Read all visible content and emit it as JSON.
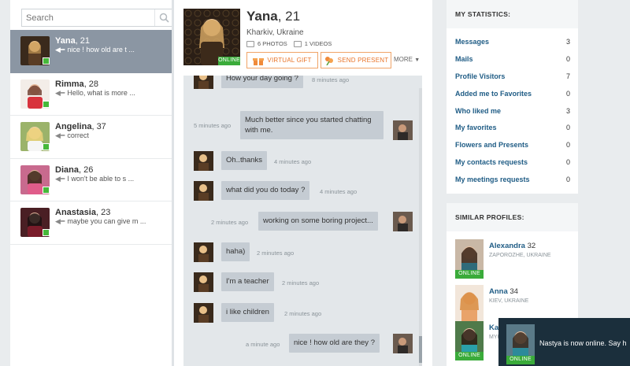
{
  "search": {
    "placeholder": "Search"
  },
  "contacts": [
    {
      "name": "Yana",
      "age": ", 21",
      "last_message": "nice ! how old are t ...",
      "active": true
    },
    {
      "name": "Rimma",
      "age": ", 28",
      "last_message": "Hello, what is more ...",
      "active": false
    },
    {
      "name": "Angelina",
      "age": ", 37",
      "last_message": "correct",
      "active": false
    },
    {
      "name": "Diana",
      "age": ", 26",
      "last_message": "I won't be able to s ...",
      "active": false
    },
    {
      "name": "Anastasia",
      "age": ", 23",
      "last_message": "maybe you can give m ...",
      "active": false
    }
  ],
  "profile": {
    "name": "Yana",
    "age": ", 21",
    "location": "Kharkiv, Ukraine",
    "photos": "6 PHOTOS",
    "videos": "1 VIDEOS",
    "online_label": "ONLINE",
    "virtual_gift": "VIRTUAL GIFT",
    "send_present": "SEND PRESENT",
    "more": "MORE"
  },
  "messages": [
    {
      "from": "her",
      "text": "How your day going ?",
      "time": "8 minutes ago"
    },
    {
      "from": "me",
      "text": "Much better since you started chatting with me.",
      "time": "5 minutes ago"
    },
    {
      "from": "her",
      "text": "Oh..thanks",
      "time": "4 minutes ago"
    },
    {
      "from": "her",
      "text": "what did you do today ?",
      "time": "4 minutes ago"
    },
    {
      "from": "me",
      "text": "working on some boring project...",
      "time": "2 minutes ago"
    },
    {
      "from": "her",
      "text": "haha)",
      "time": "2 minutes ago"
    },
    {
      "from": "her",
      "text": "I'm a teacher",
      "time": "2 minutes ago"
    },
    {
      "from": "her",
      "text": "i like children",
      "time": "2 minutes ago"
    },
    {
      "from": "me",
      "text": "nice ! how old are they ?",
      "time": "a minute ago"
    }
  ],
  "stats": {
    "title": "MY STATISTICS:",
    "items": [
      {
        "label": "Messages",
        "value": "3"
      },
      {
        "label": "Mails",
        "value": "0"
      },
      {
        "label": "Profile Visitors",
        "value": "7"
      },
      {
        "label": "Added me to Favorites",
        "value": "0"
      },
      {
        "label": "Who liked me",
        "value": "3"
      },
      {
        "label": "My favorites",
        "value": "0"
      },
      {
        "label": "Flowers and Presents",
        "value": "0"
      },
      {
        "label": "My contacts requests",
        "value": "0"
      },
      {
        "label": "My meetings requests",
        "value": "0"
      }
    ]
  },
  "similar": {
    "title": "SIMILAR PROFILES:",
    "items": [
      {
        "name": "Alexandra",
        "age": " 32",
        "location": "ZAPOROZHE, UKRAINE",
        "online_label": "ONLINE"
      },
      {
        "name": "Anna",
        "age": " 34",
        "location": "KIEV, UKRAINE",
        "online_label": ""
      },
      {
        "name": "Kat",
        "age": "",
        "location": "MYK",
        "online_label": "ONLINE"
      }
    ]
  },
  "toast": {
    "text": "Nastya is now online. Say h",
    "online_label": "ONLINE"
  },
  "colors": {
    "accent_orange": "#e9752a",
    "online_green": "#3aab3a",
    "link_blue": "#1f5c85",
    "active_contact": "#8b96a3"
  }
}
